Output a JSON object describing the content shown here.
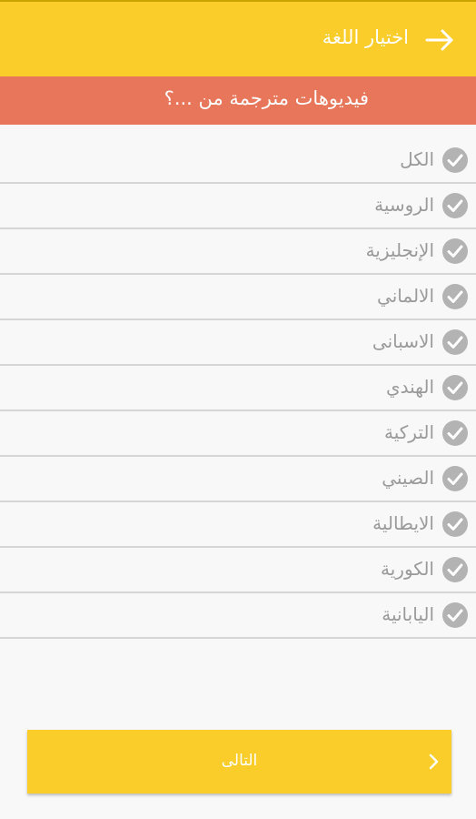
{
  "header": {
    "title": "اختيار اللغة",
    "back_icon": "arrow-right-icon"
  },
  "subheader": {
    "text": "فيديوهات مترجمة من ...؟"
  },
  "languages": {
    "items": [
      {
        "label": "الكل",
        "checked": true
      },
      {
        "label": "الروسية",
        "checked": true
      },
      {
        "label": "الإنجليزية",
        "checked": true
      },
      {
        "label": "الالماني",
        "checked": true
      },
      {
        "label": "الاسبانى",
        "checked": true
      },
      {
        "label": "الهندي",
        "checked": true
      },
      {
        "label": "التركية",
        "checked": true
      },
      {
        "label": "الصيني",
        "checked": true
      },
      {
        "label": "الايطالية",
        "checked": true
      },
      {
        "label": "الكورية",
        "checked": true
      },
      {
        "label": "اليابانية",
        "checked": true
      }
    ]
  },
  "footer": {
    "next_label": "التالى",
    "chevron_icon": "chevron-right-icon"
  },
  "colors": {
    "accent_yellow": "#fbcd2a",
    "subheader_orange": "#e8765a",
    "check_gray": "#b3b3b3",
    "label_gray": "#9a9a9a"
  }
}
